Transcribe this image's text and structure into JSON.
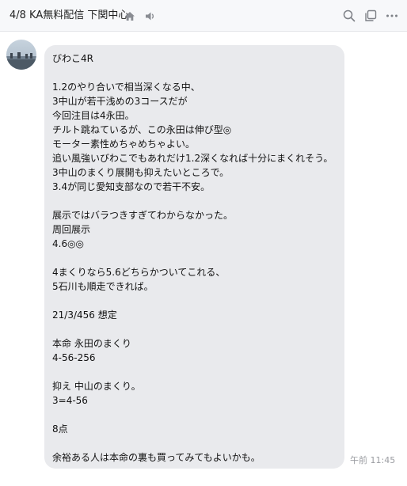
{
  "header": {
    "title": "4/8 KA無料配信 下関中心",
    "icons": [
      "home-icon",
      "speaker-icon",
      "search-icon",
      "copy-icon",
      "more-icon"
    ]
  },
  "message": {
    "lines": [
      "びわこ4R",
      "",
      "1.2のやり合いで相当深くなる中、",
      "3中山が若干浅めの3コースだが",
      "今回注目は4永田。",
      "チルト跳ねているが、この永田は伸び型◎",
      "モーター素性めちゃめちゃよい。",
      "追い風強いびわこでもあれだけ1.2深くなれば十分にまくれそう。",
      "3中山のまくり展開も抑えたいところで。",
      "3.4が同じ愛知支部なので若干不安。",
      "",
      "展示ではバラつきすぎてわからなかった。",
      "周回展示",
      "4.6◎◎",
      "",
      "4まくりなら5.6どちらかついてこれる、",
      "5石川も順走できれば。",
      "",
      "21/3/456 想定",
      "",
      "本命 永田のまくり",
      "4-56-256",
      "",
      "抑え 中山のまくり。",
      "3=4-56",
      "",
      "8点",
      "",
      "余裕ある人は本命の裏も買ってみてもよいかも。"
    ],
    "timestamp": "午前 11:45"
  },
  "colors": {
    "header_bg": "#f7f8fa",
    "bubble_bg": "#e9eaed",
    "icon": "#8a8d93",
    "timestamp": "#9a9ca1"
  }
}
